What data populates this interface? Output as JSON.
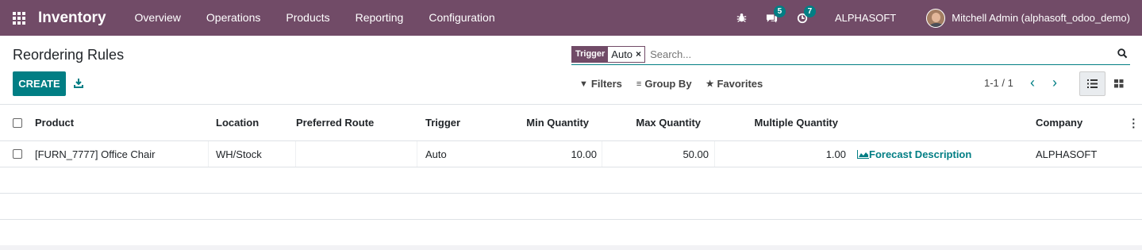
{
  "navbar": {
    "app_title": "Inventory",
    "menu": [
      "Overview",
      "Operations",
      "Products",
      "Reporting",
      "Configuration"
    ],
    "messages_count": "5",
    "activities_count": "7",
    "company": "ALPHASOFT",
    "user": "Mitchell Admin (alphasoft_odoo_demo)",
    "bg_color": "#714B67"
  },
  "control_panel": {
    "title": "Reordering Rules",
    "create_label": "CREATE",
    "search": {
      "facet_category": "Trigger",
      "facet_value": "Auto",
      "placeholder": "Search..."
    },
    "filters_label": "Filters",
    "group_by_label": "Group By",
    "favorites_label": "Favorites",
    "pager": "1-1 / 1"
  },
  "table": {
    "headers": {
      "product": "Product",
      "location": "Location",
      "route": "Preferred Route",
      "trigger": "Trigger",
      "min_qty": "Min Quantity",
      "max_qty": "Max Quantity",
      "multiple_qty": "Multiple Quantity",
      "company": "Company"
    },
    "rows": [
      {
        "product": "[FURN_7777] Office Chair",
        "location": "WH/Stock",
        "route": "",
        "trigger": "Auto",
        "min_qty": "10.00",
        "max_qty": "50.00",
        "multiple_qty": "1.00",
        "forecast": "Forecast Description",
        "company": "ALPHASOFT"
      }
    ]
  },
  "accent_color": "#017e84"
}
